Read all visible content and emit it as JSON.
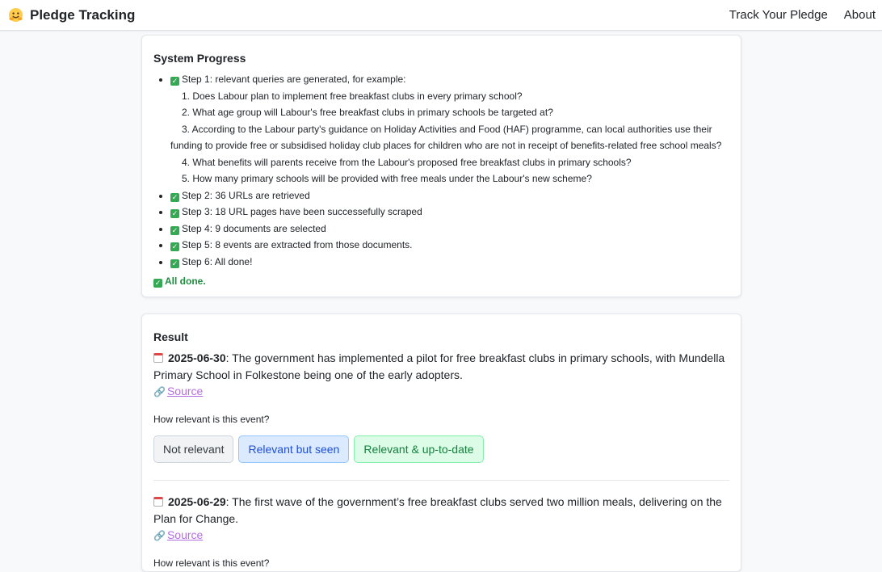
{
  "nav": {
    "brand_icon": "hugging-face-emoji-icon",
    "brand": "Pledge Tracking",
    "links": [
      "Track Your Pledge",
      "About"
    ]
  },
  "progress": {
    "title": "System Progress",
    "step1_label": "Step 1: relevant queries are generated, for example:",
    "queries": [
      "1. Does Labour plan to implement free breakfast clubs in every primary school?",
      "2. What age group will Labour's free breakfast clubs in primary schools be targeted at?",
      "3. According to the Labour party's guidance on Holiday Activities and Food (HAF) programme, can local authorities use their funding to provide free or subsidised holiday club places for children who are not in receipt of benefits-related free school meals?",
      "4. What benefits will parents receive from the Labour's proposed free breakfast clubs in primary schools?",
      "5. How many primary schools will be provided with free meals under the Labour's new scheme?"
    ],
    "steps": [
      "Step 2: 36 URLs are retrieved",
      "Step 3: 18 URL pages have been successefully scraped",
      "Step 4: 9 documents are selected",
      "Step 5: 8 events are extracted from those documents.",
      "Step 6: All done!"
    ],
    "check_glyph": "✓",
    "done": "All done.",
    "done_color": "#1e8e3e"
  },
  "result": {
    "title": "Result",
    "events": [
      {
        "date": "2025-06-30",
        "text": ": The government has implemented a pilot for free breakfast clubs in primary schools, with Mundella Primary School in Folkestone being one of the early adopters.",
        "source": "Source",
        "question": "How relevant is this event?",
        "buttons": [
          "Not relevant",
          "Relevant but seen",
          "Relevant & up-to-date"
        ]
      },
      {
        "date": "2025-06-29",
        "text": ": The first wave of the government’s free breakfast clubs served two million meals, delivering on the Plan for Change.",
        "source": "Source",
        "question": "How relevant is this event?"
      }
    ]
  },
  "colors": {
    "link": "#b46ee0",
    "check": "#34a853",
    "btn_seen": "#dbeafe",
    "btn_uptodate": "#dcfce7"
  }
}
